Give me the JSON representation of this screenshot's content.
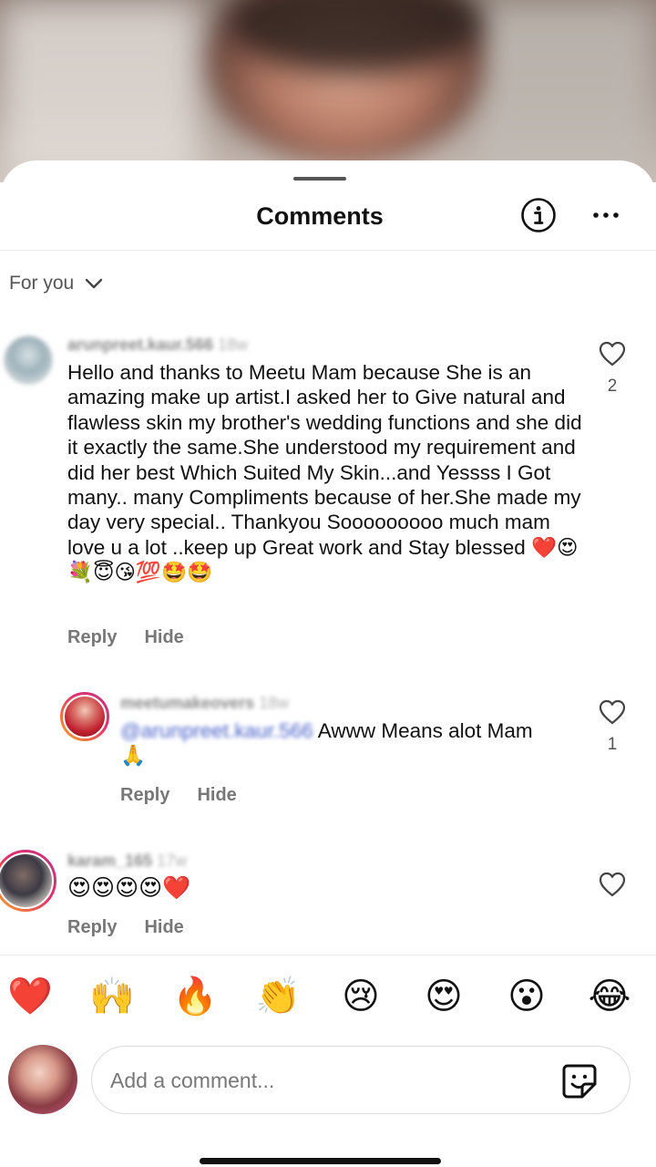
{
  "header": {
    "title": "Comments",
    "info_icon": "info-circle-icon",
    "more_icon": "more-horizontal-icon"
  },
  "filter": {
    "label": "For you",
    "icon": "chevron-down-icon"
  },
  "comments": [
    {
      "username": "arunpreet.kaur.566",
      "time": "18w",
      "text": "Hello and thanks to Meetu Mam  because She is an amazing  make up artist.I asked her to Give natural and flawless skin my brother's wedding functions  and she did it exactly the same.She understood my requirement and did her best Which Suited My Skin...and Yessss I Got many.. many Compliments because of her.She made my day very special.. Thankyou Sooooooooo much mam  love u a lot ..keep up Great work and Stay blessed ❤️😍💐😇😘💯🤩🤩",
      "likes": "2",
      "reply_label": "Reply",
      "hide_label": "Hide"
    },
    {
      "username": "meetumakeovers",
      "time": "18w",
      "mention": "@arunpreet.kaur.566",
      "text": " Awww Means alot Mam🙏",
      "likes": "1",
      "reply_label": "Reply",
      "hide_label": "Hide"
    },
    {
      "username": "karam_165",
      "time": "17w",
      "text": "😍😍😍😍❤️",
      "likes": "",
      "reply_label": "Reply",
      "hide_label": "Hide"
    }
  ],
  "reactions": [
    "❤️",
    "🙌",
    "🔥",
    "👏",
    "😢",
    "😍",
    "😮",
    "😂"
  ],
  "composer": {
    "placeholder": "Add a comment...",
    "sticker_icon": "sticker-icon"
  },
  "colors": {
    "mention": "#4a62c9",
    "story_ring": "#e1306c",
    "heart": "#e0245e"
  }
}
